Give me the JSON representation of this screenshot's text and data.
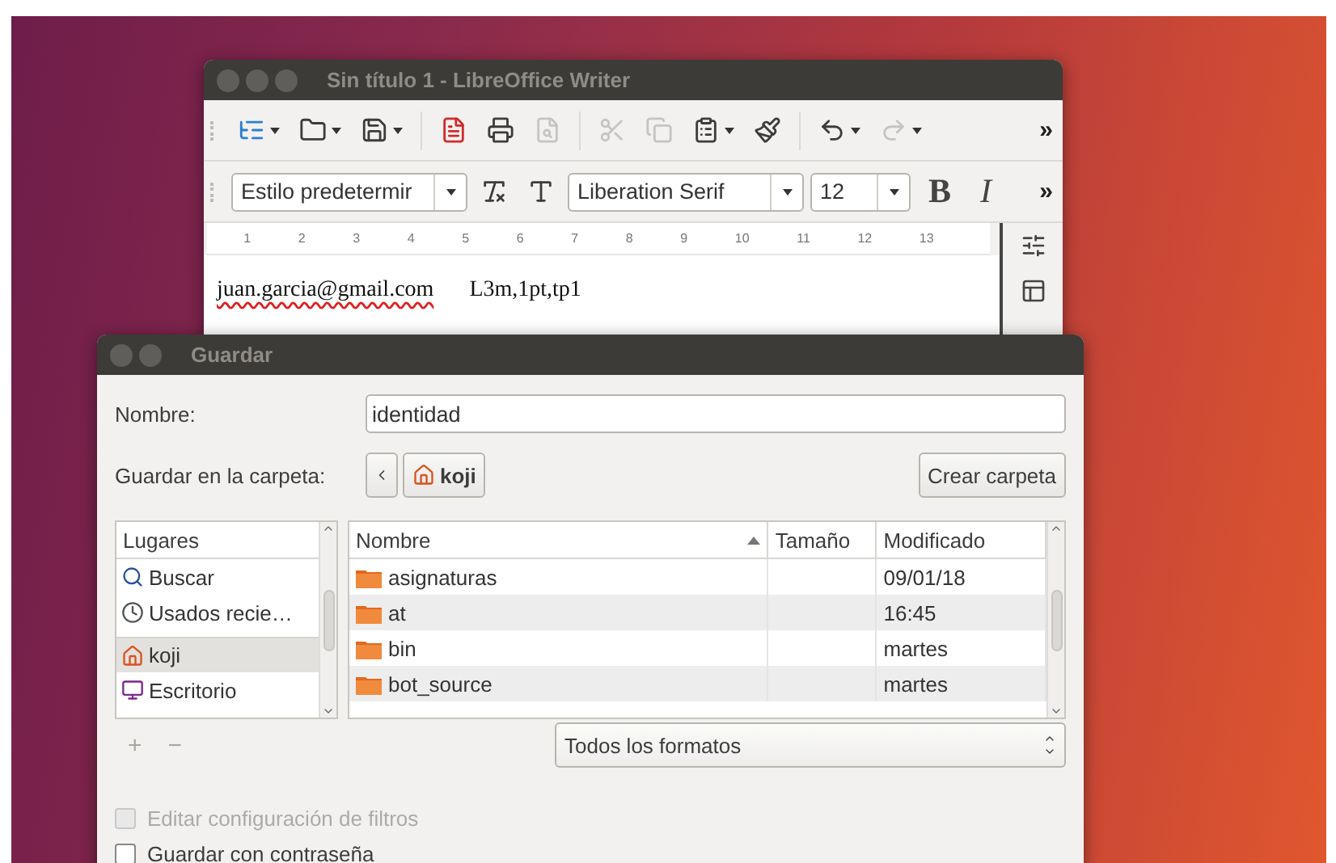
{
  "writer": {
    "title": "Sin título 1 - LibreOffice Writer",
    "toolbar": [
      {
        "kind": "sidebar",
        "disabled": false,
        "dropdown": true
      },
      {
        "kind": "open",
        "disabled": false,
        "dropdown": true
      },
      {
        "kind": "save",
        "disabled": false,
        "dropdown": true
      },
      {
        "kind": "pdf",
        "disabled": false,
        "dropdown": false
      },
      {
        "kind": "print",
        "disabled": false,
        "dropdown": false
      },
      {
        "kind": "preview",
        "disabled": true,
        "dropdown": false
      },
      {
        "kind": "cut",
        "disabled": true,
        "dropdown": false
      },
      {
        "kind": "copy",
        "disabled": true,
        "dropdown": false
      },
      {
        "kind": "paste",
        "disabled": false,
        "dropdown": true
      },
      {
        "kind": "brush",
        "disabled": false,
        "dropdown": false
      },
      {
        "kind": "undo",
        "disabled": false,
        "dropdown": true
      },
      {
        "kind": "redo",
        "disabled": true,
        "dropdown": true
      }
    ],
    "toolbar_overflow": "»",
    "paragraph_style": "Estilo predetermir",
    "font_name": "Liberation Serif",
    "font_size": "12",
    "format_buttons": [
      "B",
      "I"
    ],
    "format_overflow": "»",
    "ruler": [
      "1",
      "2",
      "3",
      "4",
      "5",
      "6",
      "7",
      "8",
      "9",
      "10",
      "11",
      "12",
      "13"
    ],
    "document_words": [
      {
        "text": "juan.garcia@gmail.com",
        "misspelled": true
      },
      {
        "text": "L3m,1pt,tp1",
        "misspelled": false
      }
    ]
  },
  "dialog": {
    "title": "Guardar",
    "name_label": "Nombre:",
    "name_value": "identidad",
    "folder_label": "Guardar en la carpeta:",
    "folder": "koji",
    "create_folder": "Crear carpeta",
    "places": {
      "header": "Lugares",
      "items": [
        {
          "label": "Buscar",
          "kind": "search",
          "selected": false
        },
        {
          "label": "Usados recie…",
          "kind": "recent",
          "selected": false
        },
        {
          "label": "koji",
          "kind": "home",
          "selected": true
        },
        {
          "label": "Escritorio",
          "kind": "desktop",
          "selected": false
        }
      ]
    },
    "place_buttons": [
      {
        "label": "+",
        "disabled": true
      },
      {
        "label": "−",
        "disabled": true
      }
    ],
    "files": {
      "columns": [
        {
          "label": "Nombre",
          "sorted": true
        },
        {
          "label": "Tamaño",
          "sorted": false
        },
        {
          "label": "Modificado",
          "sorted": false
        }
      ],
      "rows": [
        {
          "name": "asignaturas",
          "size": "",
          "modified": "09/01/18"
        },
        {
          "name": "at",
          "size": "",
          "modified": "16:45"
        },
        {
          "name": "bin",
          "size": "",
          "modified": "martes"
        },
        {
          "name": "bot_source",
          "size": "",
          "modified": "martes"
        }
      ]
    },
    "filter": "Todos los formatos",
    "options": [
      {
        "label": "Editar configuración de filtros",
        "checked": false,
        "disabled": true
      },
      {
        "label": "Guardar con contraseña",
        "checked": false,
        "disabled": false
      }
    ]
  }
}
